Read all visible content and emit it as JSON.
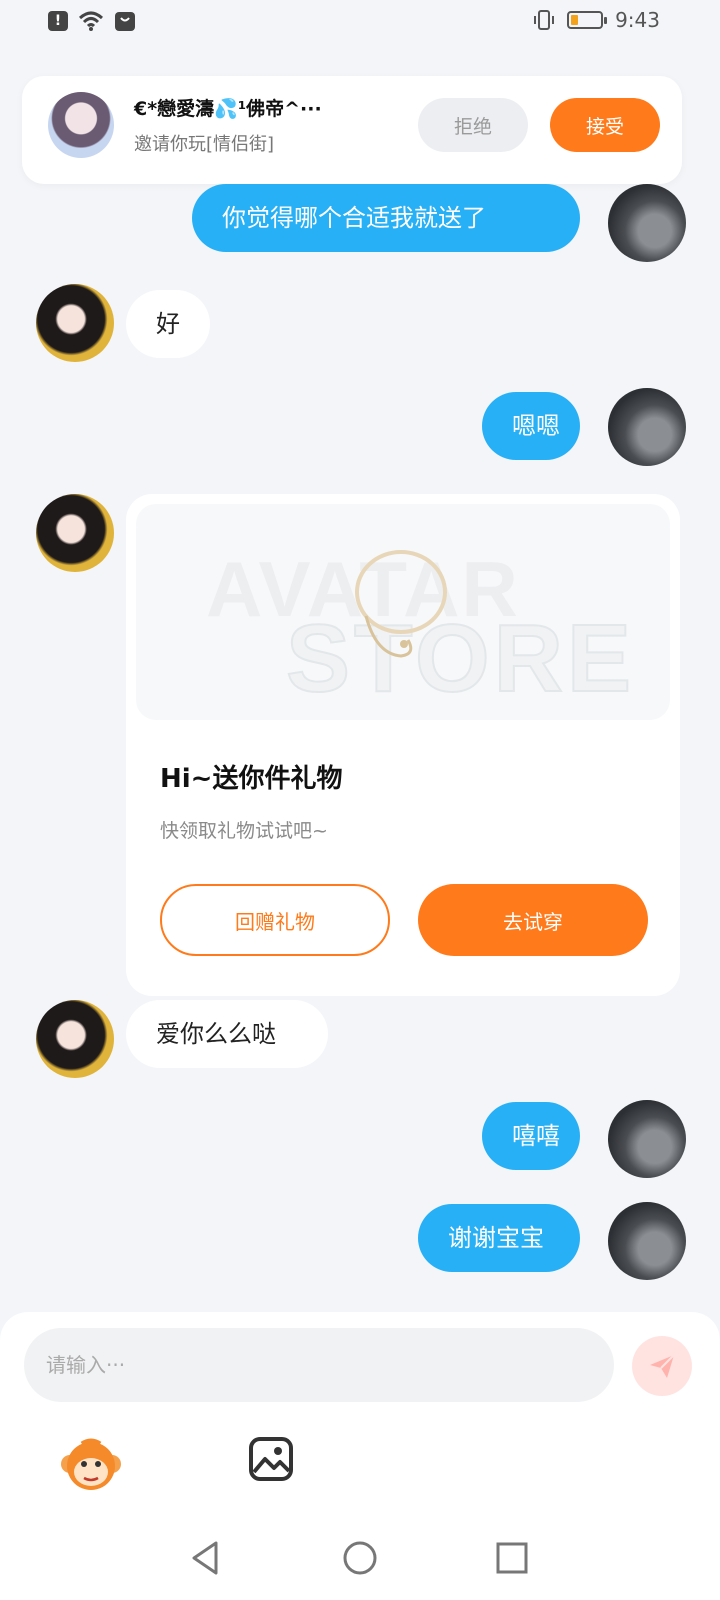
{
  "status_bar": {
    "time": "9:43",
    "battery_level": 0.25,
    "alert_glyph": "!"
  },
  "invitation": {
    "name": "€*戀愛濤💦¹佛帝^···",
    "message": "邀请你玩[情侣街]",
    "reject_label": "拒绝",
    "accept_label": "接受"
  },
  "messages": [
    {
      "sender": "me",
      "text": "你觉得哪个合适我就送了"
    },
    {
      "sender": "her",
      "text": "好"
    },
    {
      "sender": "me",
      "text": "嗯嗯"
    },
    {
      "sender": "her",
      "type": "gift"
    },
    {
      "sender": "her",
      "text": "爱你么么哒"
    },
    {
      "sender": "me",
      "text": "嘻嘻"
    },
    {
      "sender": "me",
      "text": "谢谢宝宝"
    }
  ],
  "gift_card": {
    "watermark_top": "AVATAR",
    "watermark_bottom": "STORE",
    "title": "Hi~送你件礼物",
    "subtitle": "快领取礼物试试吧~",
    "return_label": "回赠礼物",
    "try_label": "去试穿"
  },
  "input": {
    "placeholder": "请输入···"
  },
  "colors": {
    "accent_orange": "#ff7a1a",
    "bubble_blue": "#27b0f5",
    "background": "#f3f5f8"
  },
  "icons": {
    "send": "send-icon",
    "emoji": "monkey-emoji-icon",
    "image": "image-icon",
    "back": "back-icon",
    "home": "home-icon",
    "recents": "recents-icon"
  }
}
